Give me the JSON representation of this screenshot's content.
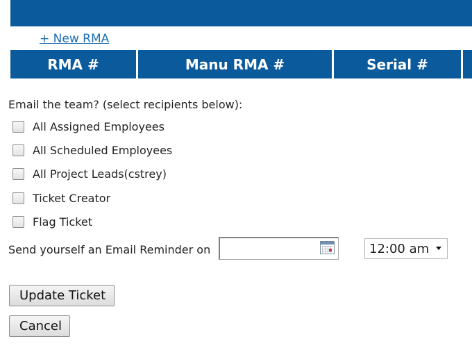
{
  "header": {
    "new_rma_link": "+ New RMA"
  },
  "rma_table": {
    "columns": [
      "RMA #",
      "Manu RMA #",
      "Serial #",
      ""
    ]
  },
  "email": {
    "prompt": "Email the team? (select recipients below):",
    "recipients": [
      {
        "label": "All Assigned Employees",
        "checked": false
      },
      {
        "label": "All Scheduled Employees",
        "checked": false
      },
      {
        "label": "All Project Leads(cstrey)",
        "checked": false
      },
      {
        "label": "Ticket Creator",
        "checked": false
      },
      {
        "label": "Flag Ticket",
        "checked": false
      }
    ]
  },
  "reminder": {
    "label": "Send yourself an Email Reminder on",
    "date_value": "",
    "time_value": "12:00 am"
  },
  "actions": {
    "update_label": "Update Ticket",
    "cancel_label": "Cancel"
  },
  "colors": {
    "header_blue": "#0a5a9c",
    "link_blue": "#1f6fb5"
  },
  "icons": {
    "calendar": "calendar-icon",
    "dropdown": "chevron-down-icon"
  }
}
